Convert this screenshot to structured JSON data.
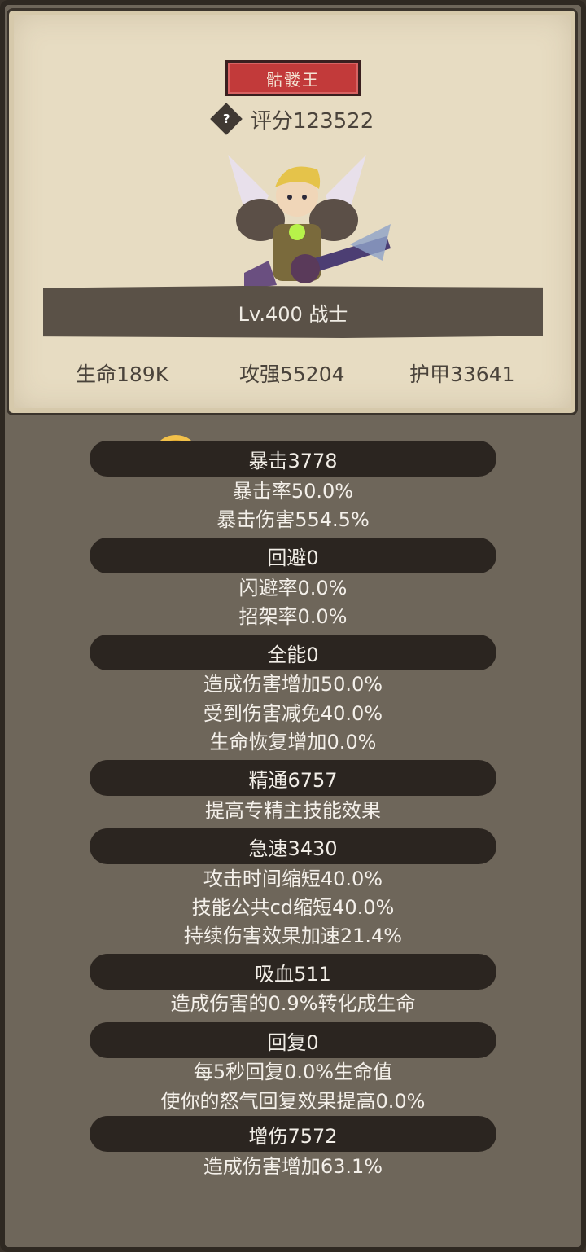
{
  "hero": {
    "name": "骷髅王",
    "score": "评分123522",
    "level": "Lv.400 战士",
    "help_icon": "?"
  },
  "stats": {
    "hp": "生命189K",
    "attack": "攻强55204",
    "armor": "护甲33641"
  },
  "sections": [
    {
      "title": "暴击3778",
      "lines": [
        "暴击率50.0%",
        "暴击伤害554.5%"
      ]
    },
    {
      "title": "回避0",
      "lines": [
        "闪避率0.0%",
        "招架率0.0%"
      ]
    },
    {
      "title": "全能0",
      "lines": [
        "造成伤害增加50.0%",
        "受到伤害减免40.0%",
        "生命恢复增加0.0%"
      ]
    },
    {
      "title": "精通6757",
      "lines": [
        "提高专精主技能效果"
      ]
    },
    {
      "title": "急速3430",
      "lines": [
        "攻击时间缩短40.0%",
        "技能公共cd缩短40.0%",
        "持续伤害效果加速21.4%"
      ]
    },
    {
      "title": "吸血511",
      "lines": [
        "造成伤害的0.9%转化成生命"
      ]
    },
    {
      "title": "回复0",
      "lines": [
        "每5秒回复0.0%生命值",
        "使你的怒气回复效果提高0.0%"
      ]
    },
    {
      "title": "增伤7572",
      "lines": [
        "造成伤害增加63.1%"
      ]
    }
  ],
  "colors": {
    "name_plate": "#c23a3a",
    "panel_bg": "#e7dcc2",
    "body_bg": "#6e665a"
  }
}
